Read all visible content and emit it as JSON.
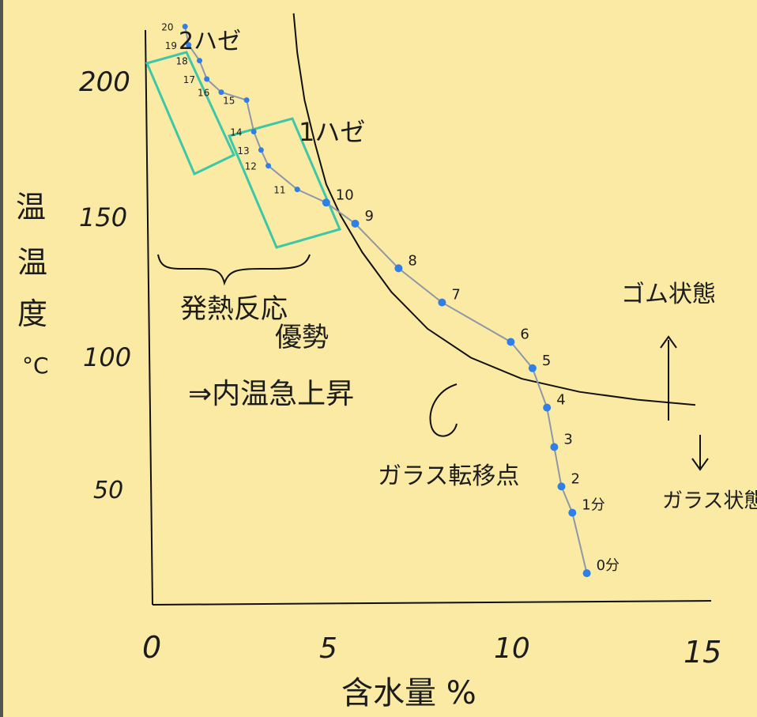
{
  "chart_data": {
    "type": "line",
    "title": "",
    "xlabel": "含水量 %",
    "ylabel": "温度 °C",
    "y_axis_title_parts": [
      "温",
      "温",
      "度",
      "°C"
    ],
    "xlim": [
      0,
      15
    ],
    "ylim": [
      0,
      200
    ],
    "x_ticks": [
      "0",
      "5",
      "10",
      "15"
    ],
    "y_ticks": [
      "200",
      "150",
      "100",
      "50"
    ],
    "series": [
      {
        "name": "",
        "color": "#8e97a8",
        "marker_color": "#2f7fe6",
        "x": [
          12.0,
          11.6,
          11.3,
          11.1,
          10.9,
          10.5,
          9.9,
          8.0,
          6.8,
          5.6,
          4.8,
          4.0,
          3.2,
          3.0,
          2.8,
          2.6,
          1.9,
          1.5,
          1.3,
          1.0,
          0.9
        ],
        "y": [
          12,
          35,
          45,
          60,
          75,
          90,
          100,
          115,
          128,
          145,
          153,
          158,
          167,
          173,
          180,
          192,
          195,
          200,
          207,
          213,
          220
        ],
        "labels": [
          "0分",
          "1分",
          "2",
          "3",
          "4",
          "5",
          "6",
          "7",
          "8",
          "9",
          "10",
          "11",
          "12",
          "13",
          "14",
          "15",
          "16",
          "17",
          "18",
          "19",
          "20"
        ]
      }
    ],
    "glass_transition_curve": {
      "name": "ガラス転移点",
      "color": "#111111",
      "x": [
        3.9,
        4.0,
        4.2,
        4.5,
        4.8,
        5.2,
        5.8,
        6.6,
        7.6,
        8.8,
        10.2,
        11.8,
        13.4,
        15.0
      ],
      "y": [
        225,
        210,
        192,
        175,
        160,
        148,
        134,
        119,
        105,
        94,
        86,
        81,
        78,
        76
      ]
    },
    "annotations": [
      {
        "text": "2ハゼ",
        "kind": "box-label"
      },
      {
        "text": "1ハゼ",
        "kind": "box-label"
      },
      {
        "text": "発熱反応",
        "kind": "note"
      },
      {
        "text": "優勢",
        "kind": "note"
      },
      {
        "text": "⇒内温急上昇",
        "kind": "note"
      },
      {
        "text": "ゴム状態",
        "kind": "region"
      },
      {
        "text": "ガラス状態",
        "kind": "region"
      },
      {
        "text": "ガラス転移点",
        "kind": "curve-label"
      }
    ],
    "box_color": "#3ec7a6",
    "grid": false,
    "legend": "none"
  }
}
